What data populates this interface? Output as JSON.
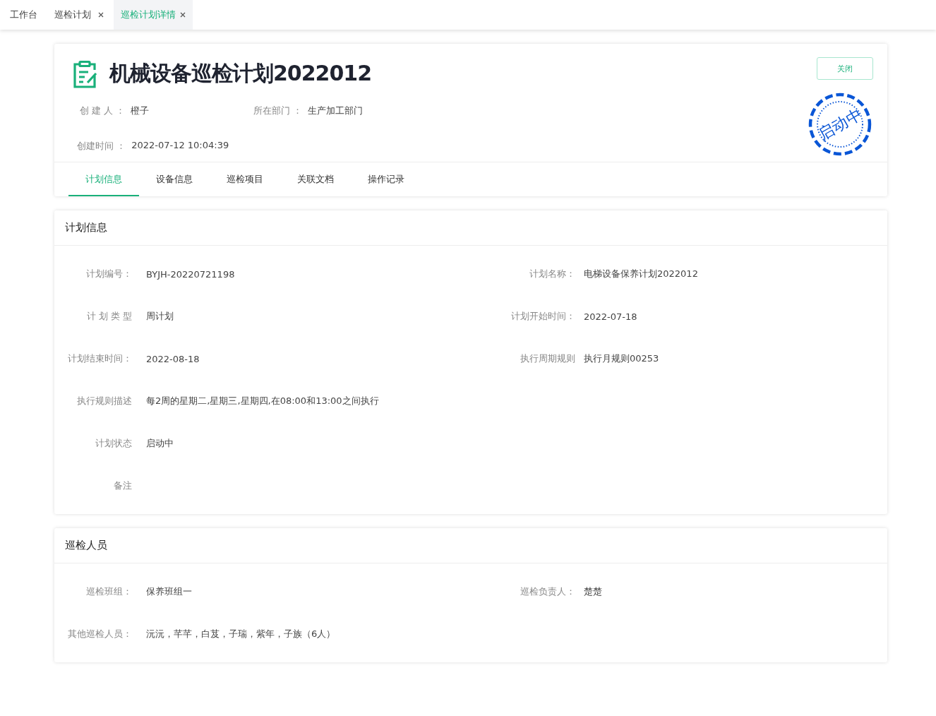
{
  "tabs": [
    {
      "label": "工作台",
      "closable": false,
      "selected": false
    },
    {
      "label": "巡检计划",
      "closable": true,
      "selected": false
    },
    {
      "label": "巡检计划详情",
      "closable": true,
      "selected": true
    }
  ],
  "header": {
    "title": "机械设备巡检计划2022012",
    "close_button": "关闭",
    "status_stamp": "启动中",
    "meta": [
      [
        {
          "label": "创 建 人 ：",
          "value": "橙子"
        },
        {
          "label": "所在部门 ：",
          "value": "生产加工部门"
        }
      ],
      [
        {
          "label": "创建时间 ：",
          "value": "2022-07-12 10:04:39"
        }
      ]
    ],
    "tabs": [
      {
        "label": "计划信息",
        "selected": true
      },
      {
        "label": "设备信息",
        "selected": false
      },
      {
        "label": "巡检项目",
        "selected": false
      },
      {
        "label": "关联文档",
        "selected": false
      },
      {
        "label": "操作记录",
        "selected": false
      }
    ]
  },
  "sections": [
    {
      "title": "计划信息",
      "rows": [
        {
          "left": {
            "label": "计划编号：",
            "value": "BYJH-20220721198"
          },
          "right": {
            "label": "计划名称：",
            "value": "电梯设备保养计划2022012"
          }
        },
        {
          "left": {
            "label": "计 划 类 型",
            "value": "周计划"
          },
          "right": {
            "label": "计划开始时间：",
            "value": "2022-07-18"
          }
        },
        {
          "left": {
            "label": "计划结束时间：",
            "value": "2022-08-18"
          },
          "right": {
            "label": "执行周期规则",
            "value": "执行月规则00253"
          }
        },
        {
          "left": {
            "label": "执行规则描述",
            "value": "每2周的星期二,星期三,星期四,在08:00和13:00之间执行"
          }
        },
        {
          "left": {
            "label": "计划状态",
            "value": "启动中"
          }
        },
        {
          "left": {
            "label": "备注"
          }
        }
      ]
    },
    {
      "title": "巡检人员",
      "rows": [
        {
          "left": {
            "label": "巡检班组：",
            "value": "保养班组一"
          },
          "right": {
            "label": "巡检负责人：",
            "value": "楚楚"
          }
        },
        {
          "left": {
            "label": "其他巡检人员：",
            "value": "沅沅，芊芊，白芨，子瑞，紫年，子族（6人）"
          }
        }
      ]
    }
  ]
}
